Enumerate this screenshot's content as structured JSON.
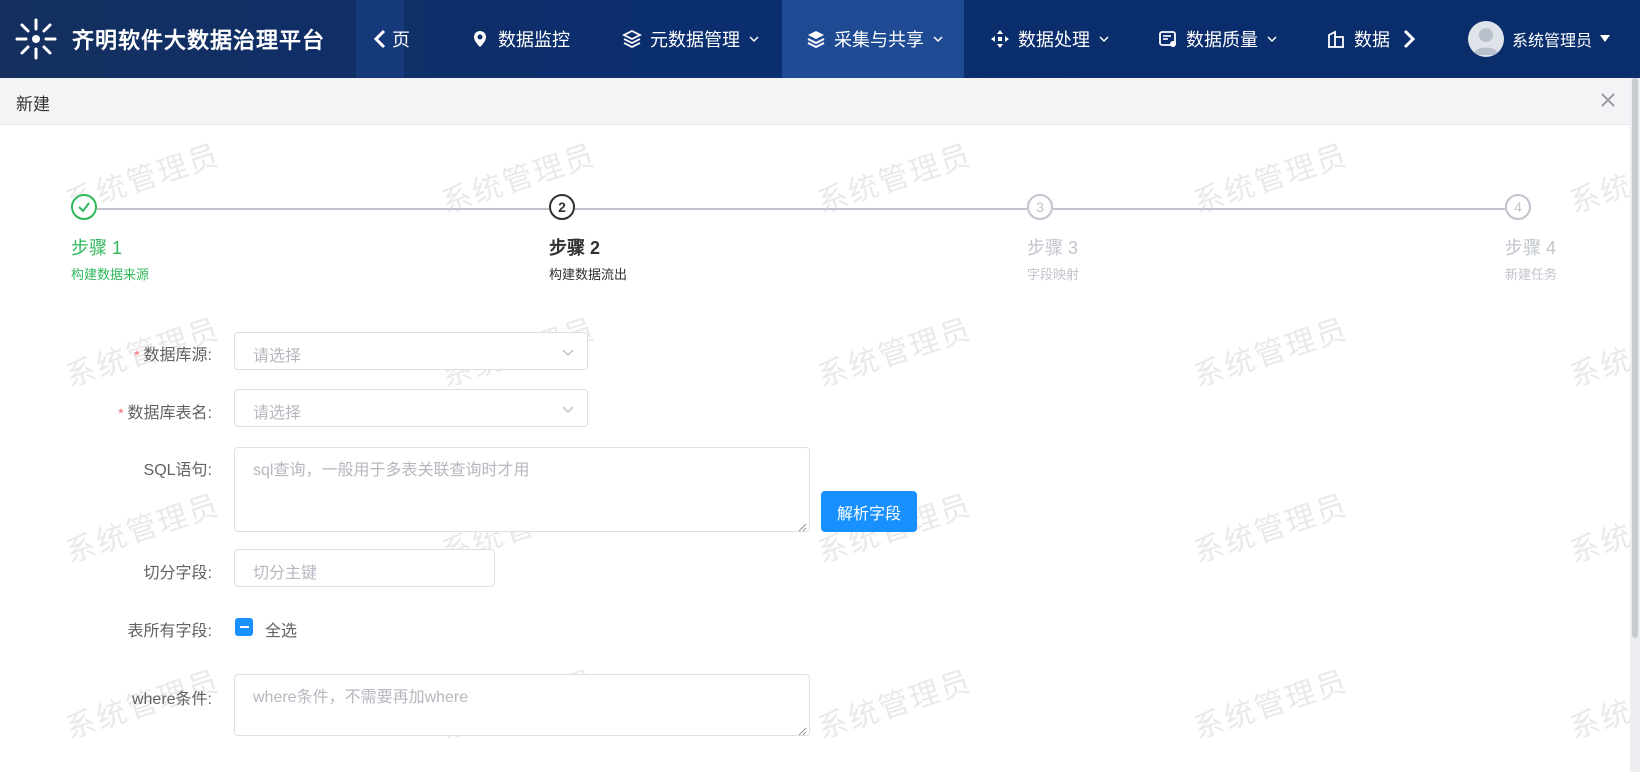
{
  "app": {
    "title": "齐明软件大数据治理平台",
    "nav_fragment": "页",
    "nav": [
      {
        "label": "数据监控",
        "icon": "monitor-pin-icon",
        "has_dropdown": false,
        "active": false
      },
      {
        "label": "元数据管理",
        "icon": "layers-icon",
        "has_dropdown": true,
        "active": false
      },
      {
        "label": "采集与共享",
        "icon": "stack-icon",
        "has_dropdown": true,
        "active": true
      },
      {
        "label": "数据处理",
        "icon": "move-arrows-icon",
        "has_dropdown": true,
        "active": false
      },
      {
        "label": "数据质量",
        "icon": "quality-card-icon",
        "has_dropdown": true,
        "active": false
      },
      {
        "label": "数据",
        "icon": "building-icon",
        "has_dropdown": false,
        "active": false
      }
    ],
    "user": {
      "name": "系统管理员",
      "avatar_icon": "user-avatar-icon"
    }
  },
  "dialog": {
    "title": "新建",
    "close_icon": "close-icon"
  },
  "watermark": "系统管理员",
  "steps": [
    {
      "number": "1",
      "title": "步骤 1",
      "desc": "构建数据来源",
      "status": "done"
    },
    {
      "number": "2",
      "title": "步骤 2",
      "desc": "构建数据流出",
      "status": "current"
    },
    {
      "number": "3",
      "title": "步骤 3",
      "desc": "字段映射",
      "status": "wait"
    },
    {
      "number": "4",
      "title": "步骤 4",
      "desc": "新建任务",
      "status": "wait"
    }
  ],
  "form": {
    "db_source": {
      "label": "数据库源:",
      "placeholder": "请选择",
      "required": true
    },
    "db_table": {
      "label": "数据库表名:",
      "placeholder": "请选择",
      "required": true
    },
    "sql": {
      "label": "SQL语句:",
      "placeholder": "sql查询，一般用于多表关联查询时才用"
    },
    "parse_button": "解析字段",
    "split_field": {
      "label": "切分字段:",
      "placeholder": "切分主键"
    },
    "all_fields": {
      "label": "表所有字段:",
      "checkbox_label": "全选",
      "state": "indeterminate"
    },
    "where": {
      "label": "where条件:",
      "placeholder": "where条件，不需要再加where"
    }
  },
  "colors": {
    "topbar": "#0b2e6e",
    "active_nav": "#1f4b95",
    "primary": "#1890ff",
    "success": "#2fb85a",
    "required": "#f56c6c"
  }
}
